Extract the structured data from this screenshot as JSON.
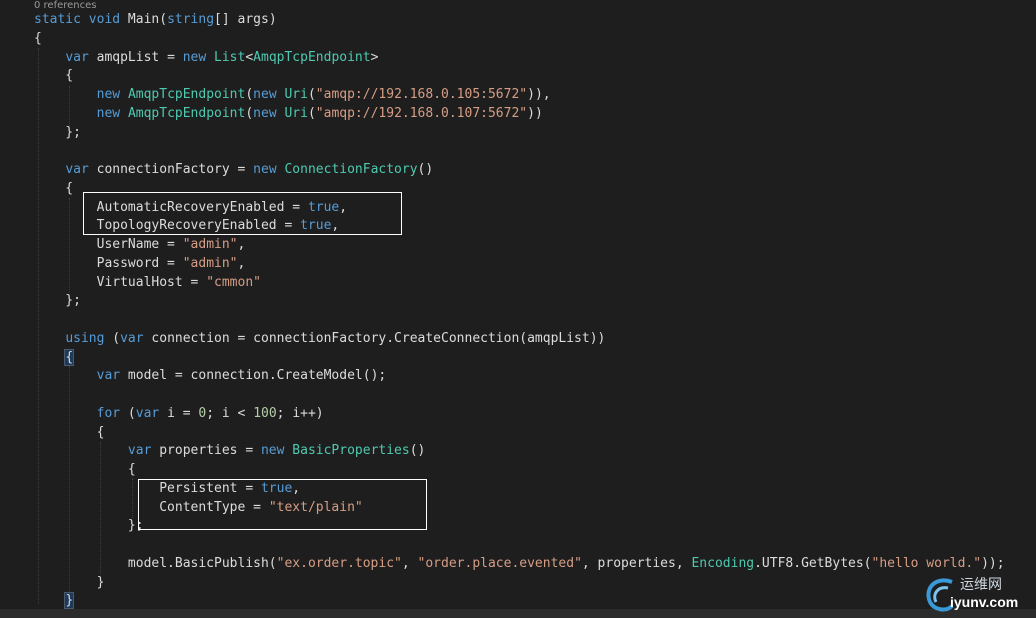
{
  "editor": {
    "codelens": "0 references",
    "lines": [
      [
        [
          "static",
          "#569cd6"
        ],
        [
          " ",
          "#dcdcdc"
        ],
        [
          "void",
          "#569cd6"
        ],
        [
          " Main(",
          "#dcdcdc"
        ],
        [
          "string",
          "#569cd6"
        ],
        [
          "[] args)",
          "#dcdcdc"
        ]
      ],
      [
        [
          "{",
          "#dcdcdc"
        ]
      ],
      [
        [
          "    ",
          "#dcdcdc"
        ],
        [
          "var",
          "#569cd6"
        ],
        [
          " amqpList = ",
          "#dcdcdc"
        ],
        [
          "new",
          "#569cd6"
        ],
        [
          " ",
          "#dcdcdc"
        ],
        [
          "List",
          "#4ec9b0"
        ],
        [
          "<",
          "#dcdcdc"
        ],
        [
          "AmqpTcpEndpoint",
          "#4ec9b0"
        ],
        [
          ">",
          "#dcdcdc"
        ]
      ],
      [
        [
          "    {",
          "#dcdcdc"
        ]
      ],
      [
        [
          "        ",
          "#dcdcdc"
        ],
        [
          "new",
          "#569cd6"
        ],
        [
          " ",
          "#dcdcdc"
        ],
        [
          "AmqpTcpEndpoint",
          "#4ec9b0"
        ],
        [
          "(",
          "#dcdcdc"
        ],
        [
          "new",
          "#569cd6"
        ],
        [
          " ",
          "#dcdcdc"
        ],
        [
          "Uri",
          "#4ec9b0"
        ],
        [
          "(",
          "#dcdcdc"
        ],
        [
          "\"amqp://192.168.0.105:5672\"",
          "#d69d85"
        ],
        [
          ")),",
          "#dcdcdc"
        ]
      ],
      [
        [
          "        ",
          "#dcdcdc"
        ],
        [
          "new",
          "#569cd6"
        ],
        [
          " ",
          "#dcdcdc"
        ],
        [
          "AmqpTcpEndpoint",
          "#4ec9b0"
        ],
        [
          "(",
          "#dcdcdc"
        ],
        [
          "new",
          "#569cd6"
        ],
        [
          " ",
          "#dcdcdc"
        ],
        [
          "Uri",
          "#4ec9b0"
        ],
        [
          "(",
          "#dcdcdc"
        ],
        [
          "\"amqp://192.168.0.107:5672\"",
          "#d69d85"
        ],
        [
          "))",
          "#dcdcdc"
        ]
      ],
      [
        [
          "    };",
          "#dcdcdc"
        ]
      ],
      [
        [
          "",
          "#dcdcdc"
        ]
      ],
      [
        [
          "    ",
          "#dcdcdc"
        ],
        [
          "var",
          "#569cd6"
        ],
        [
          " connectionFactory = ",
          "#dcdcdc"
        ],
        [
          "new",
          "#569cd6"
        ],
        [
          " ",
          "#dcdcdc"
        ],
        [
          "ConnectionFactory",
          "#4ec9b0"
        ],
        [
          "()",
          "#dcdcdc"
        ]
      ],
      [
        [
          "    {",
          "#dcdcdc"
        ]
      ],
      [
        [
          "        AutomaticRecoveryEnabled = ",
          "#dcdcdc"
        ],
        [
          "true",
          "#569cd6"
        ],
        [
          ",",
          "#dcdcdc"
        ]
      ],
      [
        [
          "        TopologyRecoveryEnabled = ",
          "#dcdcdc"
        ],
        [
          "true",
          "#569cd6"
        ],
        [
          ",",
          "#dcdcdc"
        ]
      ],
      [
        [
          "        UserName = ",
          "#dcdcdc"
        ],
        [
          "\"admin\"",
          "#d69d85"
        ],
        [
          ",",
          "#dcdcdc"
        ]
      ],
      [
        [
          "        Password = ",
          "#dcdcdc"
        ],
        [
          "\"admin\"",
          "#d69d85"
        ],
        [
          ",",
          "#dcdcdc"
        ]
      ],
      [
        [
          "        VirtualHost = ",
          "#dcdcdc"
        ],
        [
          "\"cmmon\"",
          "#d69d85"
        ]
      ],
      [
        [
          "    };",
          "#dcdcdc"
        ]
      ],
      [
        [
          "",
          "#dcdcdc"
        ]
      ],
      [
        [
          "    ",
          "#dcdcdc"
        ],
        [
          "using",
          "#569cd6"
        ],
        [
          " (",
          "#dcdcdc"
        ],
        [
          "var",
          "#569cd6"
        ],
        [
          " connection = connectionFactory.CreateConnection(amqpList))",
          "#dcdcdc"
        ]
      ],
      [
        [
          "    ",
          "#dcdcdc"
        ],
        [
          "{",
          "#dcdcdc",
          "brace"
        ]
      ],
      [
        [
          "        ",
          "#dcdcdc"
        ],
        [
          "var",
          "#569cd6"
        ],
        [
          " model = connection.CreateModel();",
          "#dcdcdc"
        ]
      ],
      [
        [
          "",
          "#dcdcdc"
        ]
      ],
      [
        [
          "        ",
          "#dcdcdc"
        ],
        [
          "for",
          "#569cd6"
        ],
        [
          " (",
          "#dcdcdc"
        ],
        [
          "var",
          "#569cd6"
        ],
        [
          " i = ",
          "#dcdcdc"
        ],
        [
          "0",
          "#b5cea8"
        ],
        [
          "; i < ",
          "#dcdcdc"
        ],
        [
          "100",
          "#b5cea8"
        ],
        [
          "; i++)",
          "#dcdcdc"
        ]
      ],
      [
        [
          "        {",
          "#dcdcdc"
        ]
      ],
      [
        [
          "            ",
          "#dcdcdc"
        ],
        [
          "var",
          "#569cd6"
        ],
        [
          " properties = ",
          "#dcdcdc"
        ],
        [
          "new",
          "#569cd6"
        ],
        [
          " ",
          "#dcdcdc"
        ],
        [
          "BasicProperties",
          "#4ec9b0"
        ],
        [
          "()",
          "#dcdcdc"
        ]
      ],
      [
        [
          "            {",
          "#dcdcdc"
        ]
      ],
      [
        [
          "                Persistent = ",
          "#dcdcdc"
        ],
        [
          "true",
          "#569cd6"
        ],
        [
          ",",
          "#dcdcdc"
        ]
      ],
      [
        [
          "                ContentType = ",
          "#dcdcdc"
        ],
        [
          "\"text/plain\"",
          "#d69d85"
        ]
      ],
      [
        [
          "            };",
          "#dcdcdc"
        ]
      ],
      [
        [
          "",
          "#dcdcdc"
        ]
      ],
      [
        [
          "            model.BasicPublish(",
          "#dcdcdc"
        ],
        [
          "\"ex.order.topic\"",
          "#d69d85"
        ],
        [
          ", ",
          "#dcdcdc"
        ],
        [
          "\"order.place.evented\"",
          "#d69d85"
        ],
        [
          ", properties, ",
          "#dcdcdc"
        ],
        [
          "Encoding",
          "#4ec9b0"
        ],
        [
          ".UTF8.GetBytes(",
          "#dcdcdc"
        ],
        [
          "\"hello world.\"",
          "#d69d85"
        ],
        [
          "));",
          "#dcdcdc"
        ]
      ],
      [
        [
          "        }",
          "#dcdcdc"
        ]
      ],
      [
        [
          "    ",
          "#dcdcdc"
        ],
        [
          "}",
          "#dcdcdc",
          "brace"
        ]
      ]
    ]
  },
  "watermark": {
    "cn_text": "运维网",
    "url_text": "iyunv.com"
  }
}
